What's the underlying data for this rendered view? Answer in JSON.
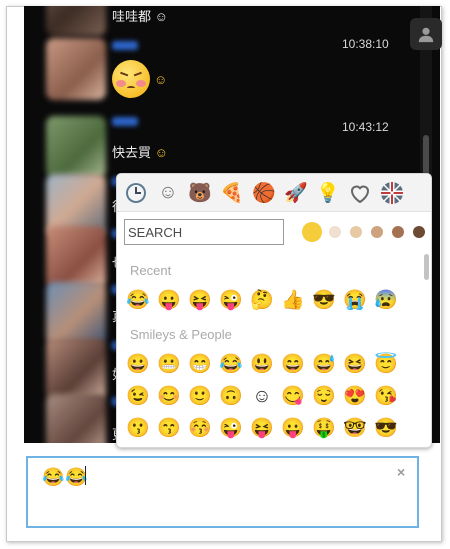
{
  "chat": {
    "messages": [
      {
        "id": "m0",
        "text": "哇哇都 ☺",
        "time": ""
      },
      {
        "id": "m1",
        "time": "10:38:10",
        "emoji_label": "☺"
      },
      {
        "id": "m2",
        "time": "10:43:12",
        "text": "快去買",
        "emoji_label": "☺"
      },
      {
        "id": "m3",
        "text": "很"
      },
      {
        "id": "m4",
        "text": "也"
      },
      {
        "id": "m5",
        "text": "真"
      },
      {
        "id": "m6",
        "text": "如"
      },
      {
        "id": "m7",
        "text": "更"
      }
    ]
  },
  "picker": {
    "categories": [
      {
        "name": "recent-clock-icon",
        "glyph": "🕒"
      },
      {
        "name": "smileys-icon",
        "glyph": "☺"
      },
      {
        "name": "animals-icon",
        "glyph": "🐻"
      },
      {
        "name": "food-icon",
        "glyph": "🍕"
      },
      {
        "name": "activity-icon",
        "glyph": "🏀"
      },
      {
        "name": "travel-icon",
        "glyph": "🚀"
      },
      {
        "name": "objects-icon",
        "glyph": "💡"
      },
      {
        "name": "symbols-icon",
        "glyph": "♡"
      },
      {
        "name": "flags-icon",
        "glyph": "🇬🇧"
      }
    ],
    "search_placeholder": "SEARCH",
    "tones": [
      "#f5cc3a",
      "#f1dfd0",
      "#e7c9a4",
      "#cda37d",
      "#a47252",
      "#6c4a33"
    ],
    "recent_label": "Recent",
    "recent": [
      "😂",
      "😛",
      "😝",
      "😜",
      "🤔",
      "👍",
      "😎",
      "😭",
      "😰"
    ],
    "smileys_label": "Smileys & People",
    "smileys_rows": [
      [
        "😀",
        "😬",
        "😁",
        "😂",
        "😃",
        "😄",
        "😅",
        "😆",
        "😇"
      ],
      [
        "😉",
        "😊",
        "🙂",
        "🙃",
        "☺",
        "😋",
        "😌",
        "😍",
        "😘"
      ],
      [
        "😗",
        "😙",
        "😚",
        "😜",
        "😝",
        "😛",
        "🤑",
        "🤓",
        "😎"
      ]
    ]
  },
  "input": {
    "emojis": [
      "😂",
      "😂"
    ],
    "clear_label": "×"
  },
  "colors": {
    "accent": "#6fb2e4",
    "chat_bg": "#0a0a0b"
  }
}
